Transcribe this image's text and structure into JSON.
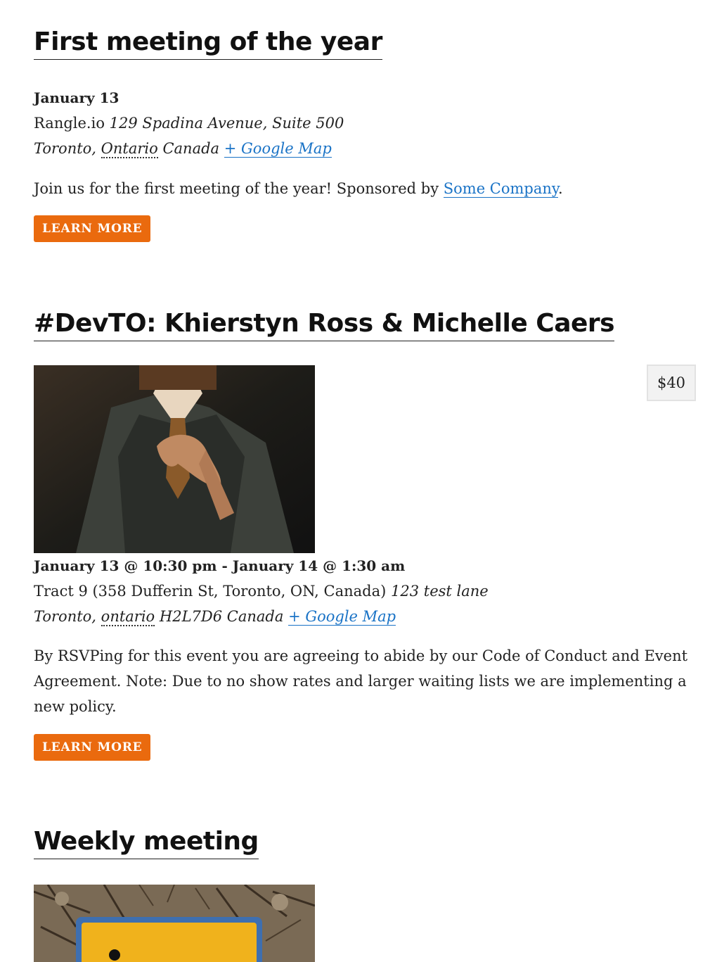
{
  "events": [
    {
      "title": "First meeting of the year",
      "date": "January 13",
      "venue": "Rangle.io",
      "address": "129 Spadina Avenue, Suite 500",
      "city": "Toronto,",
      "region": "Ontario",
      "postal": "",
      "country": "Canada",
      "map_link": "+ Google Map",
      "description_pre": "Join us for the first meeting of the year! Sponsored by ",
      "description_link": "Some Company",
      "description_post": ".",
      "button": "LEARN MORE"
    },
    {
      "title": "#DevTO: Khierstyn Ross & Michelle Caers",
      "date": "January 13 @ 10:30 pm - January 14 @ 1:30 am",
      "venue": "Tract 9 (358 Dufferin St, Toronto, ON, Canada)",
      "address": "123 test lane",
      "city": "Toronto,",
      "region": "ontario",
      "postal": "H2L7D6",
      "country": "Canada",
      "map_link": "+ Google Map",
      "price": "$40",
      "description": "By RSVPing for this event you are agreeing to abide by our Code of Conduct and Event Agreement. Note: Due to no show rates and larger waiting lists we are implementing a new policy.",
      "button": "LEARN MORE"
    },
    {
      "title": "Weekly meeting"
    }
  ],
  "colors": {
    "button": "#ea6a0e",
    "link": "#1a73c6"
  }
}
